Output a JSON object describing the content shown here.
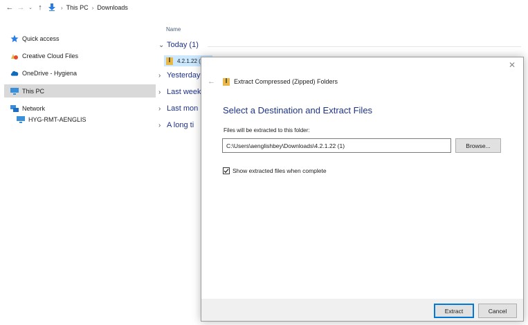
{
  "address": {
    "back_icon": "←",
    "forward_icon": "→",
    "recent_icon": "⌄",
    "up_icon": "↑",
    "separator": "›",
    "crumbs": [
      "This PC",
      "Downloads"
    ]
  },
  "sidebar": {
    "items": [
      {
        "label": "Quick access",
        "icon": "star-icon"
      },
      {
        "label": "Creative Cloud Files",
        "icon": "creative-cloud-icon"
      },
      {
        "label": "OneDrive - Hygiena",
        "icon": "cloud-icon"
      },
      {
        "label": "This PC",
        "icon": "computer-icon"
      },
      {
        "label": "Network",
        "icon": "network-icon"
      },
      {
        "label": "HYG-RMT-AENGLIS",
        "icon": "computer-icon"
      }
    ]
  },
  "filelist": {
    "column_name": "Name",
    "groups": [
      {
        "label": "Today (1)",
        "expanded": true
      },
      {
        "label": "Yesterday",
        "expanded": false
      },
      {
        "label": "Last week",
        "expanded": false
      },
      {
        "label": "Last mon",
        "expanded": false
      },
      {
        "label": "A long ti",
        "expanded": false
      }
    ],
    "file": {
      "name": "4.2.1.22 ("
    }
  },
  "dialog": {
    "close_icon": "✕",
    "back_icon": "←",
    "title": "Extract Compressed (Zipped) Folders",
    "heading": "Select a Destination and Extract Files",
    "label": "Files will be extracted to this folder:",
    "path": "C:\\Users\\aenglishbey\\Downloads\\4.2.1.22 (1)",
    "browse": "Browse...",
    "checkbox_label": "Show extracted files when complete",
    "checkbox_checked": true,
    "extract": "Extract",
    "cancel": "Cancel"
  },
  "colors": {
    "accent_blue": "#1e3287",
    "selection": "#cce8ff",
    "sidebar_selected": "#d9d9d9",
    "default_button_border": "#0078d7",
    "zip_folder": "#e8b84a"
  }
}
